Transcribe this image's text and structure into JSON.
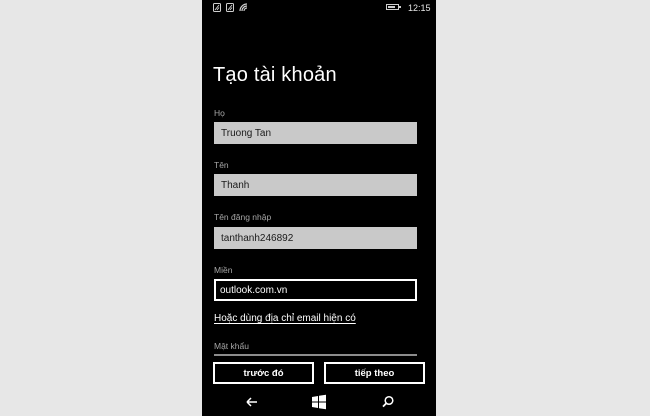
{
  "status_bar": {
    "time": "12:15",
    "icons": [
      "sim1-signal-icon",
      "sim2-signal-icon",
      "wifi-icon",
      "battery-icon"
    ],
    "battery_level": 0.8
  },
  "page": {
    "title": "Tạo tài khoản"
  },
  "form": {
    "last_name": {
      "label": "Họ",
      "value": "Truong Tan"
    },
    "first_name": {
      "label": "Tên",
      "value": "Thanh"
    },
    "username": {
      "label": "Tên đăng nhập",
      "value": "tanthanh246892"
    },
    "domain": {
      "label": "Miền",
      "value": "outlook.com.vn"
    },
    "use_existing_email_link": "Hoặc dùng địa chỉ email hiện có",
    "password": {
      "label": "Mật khẩu",
      "value": ""
    }
  },
  "buttons": {
    "back": "trước đó",
    "next": "tiếp theo"
  },
  "nav": {
    "icons": [
      "back-arrow-icon",
      "windows-start-icon",
      "search-icon"
    ]
  },
  "colors": {
    "background": "#000000",
    "text": "#ffffff",
    "label": "#a6a6a6",
    "input_fill": "#c9c9c9",
    "outer_background": "#e7e7e7"
  }
}
